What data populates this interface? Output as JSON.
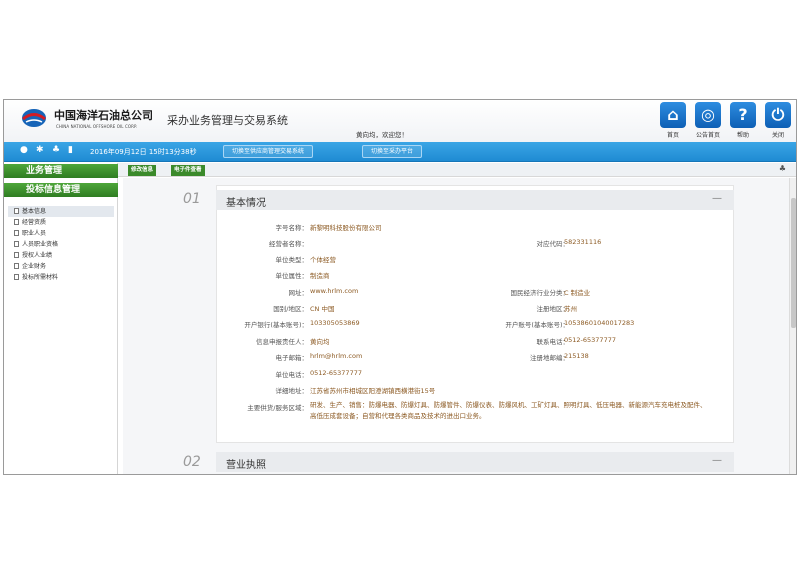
{
  "header": {
    "company_cn": "中国海洋石油总公司",
    "company_en": "CHINA NATIONAL OFFSHORE OIL CORP.",
    "system_title": "采办业务管理与交易系统",
    "welcome": "黄向均，欢迎您！",
    "buttons": [
      {
        "label": "首页",
        "icon": "home-icon"
      },
      {
        "label": "公告首页",
        "icon": "globe-icon"
      },
      {
        "label": "帮助",
        "icon": "help-icon"
      },
      {
        "label": "关闭",
        "icon": "power-icon"
      }
    ]
  },
  "toolbar": {
    "datetime": "2016年09月12日 15时13分38秒",
    "switch_supplier": "切换至供应商管理交易系统",
    "switch_procurement": "切换至采办平台"
  },
  "subbar": {
    "tabs": [
      "修改信息",
      "电子件查看"
    ]
  },
  "sidebar": {
    "heading1": "业务管理",
    "heading2": "投标信息管理",
    "items": [
      "基本信息",
      "经营资质",
      "职业人员",
      "人员职业资格",
      "授权人业绩",
      "企业财务",
      "投标所需材料"
    ]
  },
  "sections": {
    "s1_num": "01",
    "s1_title": "基本情况",
    "s2_num": "02",
    "s2_title": "营业执照",
    "collapse": "—"
  },
  "basic": {
    "l_name": "字号名称：",
    "v_name": "新黎明科技股份有限公司",
    "l_operator": "经营者名称：",
    "v_operator": "",
    "l_orgcode": "对应代码：",
    "v_orgcode": "582331116",
    "l_type": "单位类型：",
    "v_type": "个体经营",
    "l_attr": "单位属性：",
    "v_attr": "制造商",
    "l_site": "网址：",
    "v_site": "www.hrlm.com",
    "l_industry": "国民经济行业分类：",
    "v_industry": "C 制造业",
    "l_region": "国别/地区：",
    "v_region": "CN 中国",
    "l_regarea": "注册地区：",
    "v_regarea": "苏州",
    "l_bank": "开户银行(基本账号)：",
    "v_bank": "103305053869",
    "l_account": "开户账号(基本账号)：",
    "v_account": "10538601040017283",
    "l_contact": "信息申报责任人：",
    "v_contact": "黄向均",
    "l_phone": "联系电话：",
    "v_phone": "0512-65377777",
    "l_email": "电子邮箱：",
    "v_email": "hrlm@hrlm.com",
    "l_zip": "注册地邮编：",
    "v_zip": "215138",
    "l_fax": "单位电话：",
    "v_fax": "0512-65377777",
    "l_address": "详细地址：",
    "v_address": "江苏省苏州市相城区阳澄湖镇西横港街15号",
    "l_scope": "主要供货/服务区域：",
    "v_scope": "研发、生产、销售：防爆电器、防爆灯具、防爆管件、防爆仪表、防爆风机、工矿灯具、照明灯具、低压电器、新能源汽车充电桩及配件、高低压成套设备；自营和代理各类商品及技术的进出口业务。"
  },
  "colors": {
    "toolbar_blue": "#1f8bd3",
    "sidebar_green": "#2f7d22",
    "value_brown": "#8c5a23",
    "button_blue": "#0d5fb5"
  }
}
